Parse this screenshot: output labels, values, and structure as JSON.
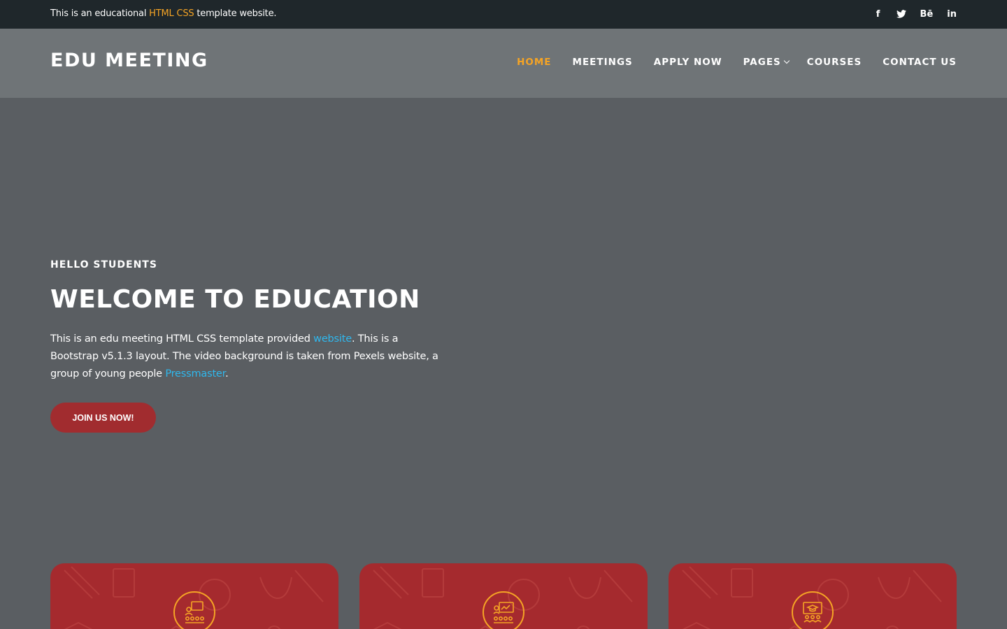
{
  "topbar": {
    "message_prefix": "This is an educational ",
    "message_highlight": "HTML CSS",
    "message_suffix": " template website.",
    "social": [
      {
        "label": "f",
        "icon": "facebook-icon"
      },
      {
        "label": "",
        "icon": "twitter-icon"
      },
      {
        "label": "Bē",
        "icon": "behance-icon"
      },
      {
        "label": "in",
        "icon": "linkedin-icon"
      }
    ]
  },
  "header": {
    "logo": "EDU MEETING",
    "nav": [
      {
        "label": "HOME",
        "active": true
      },
      {
        "label": "MEETINGS"
      },
      {
        "label": "APPLY NOW"
      },
      {
        "label": "PAGES",
        "dropdown": true
      },
      {
        "label": "COURSES"
      },
      {
        "label": "CONTACT US"
      }
    ]
  },
  "hero": {
    "kicker": "HELLO STUDENTS",
    "title": "WELCOME TO EDUCATION",
    "desc_1": "This is an edu meeting HTML CSS template provided ",
    "desc_link_1": "website",
    "desc_2": ". This is a Bootstrap v5.1.3 layout. The video background is taken from Pexels website, a group of young people ",
    "desc_link_2": "Pressmaster",
    "desc_3": ".",
    "cta": "JOIN US NOW!"
  },
  "cards": [
    {
      "icon": "meeting-group-icon"
    },
    {
      "icon": "presentation-icon"
    },
    {
      "icon": "graduation-class-icon"
    }
  ],
  "colors": {
    "accent": "#f5a425",
    "link": "#2fb8ee",
    "primary_red": "#a12c2f",
    "topbar": "#1f272b",
    "header": "#6f7477",
    "hero": "#5a5e62"
  }
}
